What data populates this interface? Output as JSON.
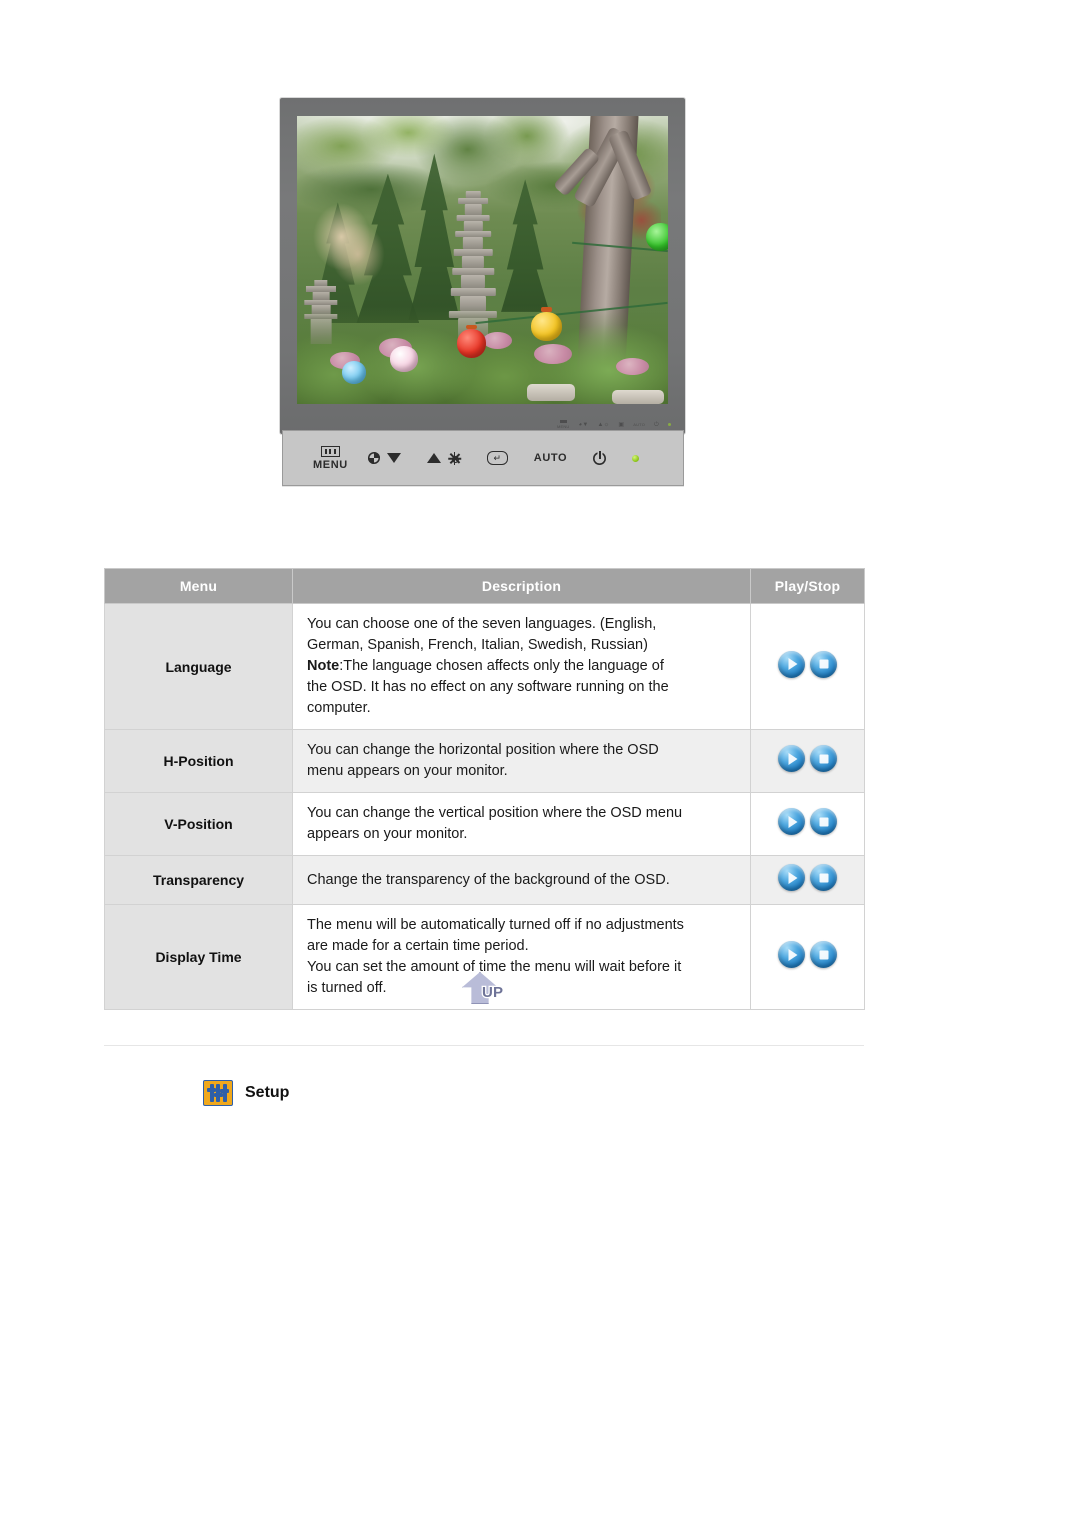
{
  "product_illustration": {
    "name": "lcd-monitor-front-view",
    "screen_scene": "garden with stone pagoda, trees and colored paper lanterns",
    "bezel_mini_controls": [
      {
        "icon": "menu-icon",
        "label": "MENU"
      },
      {
        "icon": "contrast-icon",
        "label": ""
      },
      {
        "icon": "arrow-down-icon",
        "label": ""
      },
      {
        "icon": "arrow-up-icon",
        "label": ""
      },
      {
        "icon": "brightness-icon",
        "label": ""
      },
      {
        "icon": "enter-icon",
        "label": ""
      },
      {
        "icon": "",
        "label": "AUTO"
      },
      {
        "icon": "power-icon",
        "label": ""
      },
      {
        "icon": "power-led",
        "label": ""
      }
    ]
  },
  "control_panel": {
    "name": "monitor-button-panel-detail",
    "menu_label": "MENU",
    "auto_label": "AUTO",
    "icons": {
      "menu": "menu-icon",
      "contrast": "contrast-icon",
      "down": "arrow-down-icon",
      "up": "arrow-up-icon",
      "brightness": "brightness-icon",
      "enter": "enter-icon",
      "power": "power-icon",
      "led": "power-led-icon"
    },
    "led_color": "#93c91f",
    "panel_color": "#c6c6c6"
  },
  "table": {
    "headers": [
      "Menu",
      "Description",
      "Play/Stop"
    ],
    "header_bg": "#a3a3a3",
    "header_color": "#ffffff",
    "menu_col_bg": "#e2e2e2",
    "rows": [
      {
        "menu": "Language",
        "description_lines": [
          "You can choose one of the seven languages. (English,",
          "German, Spanish, French, Italian, Swedish, Russian)"
        ],
        "note_label": "Note",
        "note_lines": [
          ":The language chosen affects only the language of",
          "the OSD. It has no effect on any software running on the",
          "computer."
        ],
        "play": "play-button",
        "stop": "stop-button"
      },
      {
        "menu": "H-Position",
        "description_lines": [
          "You can change the horizontal position where the OSD",
          "menu appears on your monitor."
        ],
        "note_label": "",
        "note_lines": [],
        "play": "play-button",
        "stop": "stop-button"
      },
      {
        "menu": "V-Position",
        "description_lines": [
          "You can change the vertical position where the OSD menu",
          "appears on your monitor."
        ],
        "note_label": "",
        "note_lines": [],
        "play": "play-button",
        "stop": "stop-button"
      },
      {
        "menu": "Transparency",
        "description_lines": [
          "Change the transparency of the background of the OSD."
        ],
        "note_label": "",
        "note_lines": [],
        "play": "play-button",
        "stop": "stop-button"
      },
      {
        "menu": "Display Time",
        "description_lines": [
          "The menu will be automatically turned off if no adjustments",
          "are made for a certain time period.",
          "You can set the amount of time the menu will wait before it",
          "is turned off."
        ],
        "note_label": "",
        "note_lines": [],
        "play": "play-button",
        "stop": "stop-button"
      }
    ]
  },
  "up_button": {
    "label": "UP",
    "icon": "up-arrow-icon",
    "color": "#b9bcd8"
  },
  "setup_section": {
    "label": "Setup",
    "icon": "setup-sliders-icon",
    "icon_bg": "#f0a81c",
    "icon_fg": "#2e5fa8"
  }
}
